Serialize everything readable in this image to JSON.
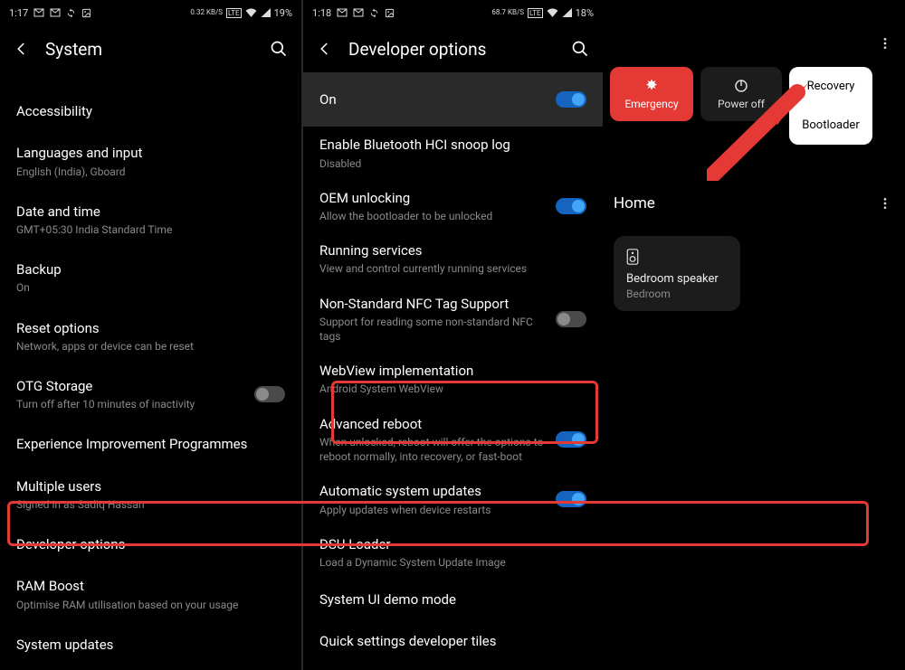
{
  "panel1": {
    "status": {
      "time": "1:17",
      "net_speed": "0.32 KB/S",
      "battery": "19%"
    },
    "title": "System",
    "items": [
      {
        "title": "Accessibility",
        "sub": ""
      },
      {
        "title": "Languages and input",
        "sub": "English (India), Gboard"
      },
      {
        "title": "Date and time",
        "sub": "GMT+05:30 India Standard Time"
      },
      {
        "title": "Backup",
        "sub": "On"
      },
      {
        "title": "Reset options",
        "sub": "Network, apps or device can be reset"
      },
      {
        "title": "OTG Storage",
        "sub": "Turn off after 10 minutes of inactivity",
        "toggle": "off"
      },
      {
        "title": "Experience Improvement Programmes",
        "sub": ""
      },
      {
        "title": "Multiple users",
        "sub": "Signed in as Sadiq Hassan"
      },
      {
        "title": "Developer options",
        "sub": ""
      },
      {
        "title": "RAM Boost",
        "sub": "Optimise RAM utilisation based on your usage"
      },
      {
        "title": "System updates",
        "sub": ""
      }
    ]
  },
  "panel2": {
    "status": {
      "time": "1:18",
      "net_speed": "68.7 KB/S",
      "battery": "18%"
    },
    "title": "Developer options",
    "items": [
      {
        "title": "On",
        "sub": "",
        "toggle": "on",
        "bg": true
      },
      {
        "title": "Enable Bluetooth HCI snoop log",
        "sub": "Disabled"
      },
      {
        "title": "OEM unlocking",
        "sub": "Allow the bootloader to be unlocked",
        "toggle": "on"
      },
      {
        "title": "Running services",
        "sub": "View and control currently running services"
      },
      {
        "title": "Non-Standard NFC Tag Support",
        "sub": "Support for reading some non-standard NFC tags",
        "toggle": "off"
      },
      {
        "title": "WebView implementation",
        "sub": "Android System WebView"
      },
      {
        "title": "Advanced reboot",
        "sub": "When unlocked, reboot will offer the options to reboot normally, into recovery, or fast-boot",
        "toggle": "on"
      },
      {
        "title": "Automatic system updates",
        "sub": "Apply updates when device restarts",
        "toggle": "on"
      },
      {
        "title": "DSU Loader",
        "sub": "Load a Dynamic System Update Image"
      },
      {
        "title": "System UI demo mode",
        "sub": ""
      },
      {
        "title": "Quick settings developer tiles",
        "sub": ""
      }
    ]
  },
  "panel3": {
    "emergency": "Emergency",
    "poweroff": "Power off",
    "recovery": "Recovery",
    "bootloader": "Bootloader",
    "home": "Home",
    "card_title": "Bedroom speaker",
    "card_sub": "Bedroom"
  }
}
